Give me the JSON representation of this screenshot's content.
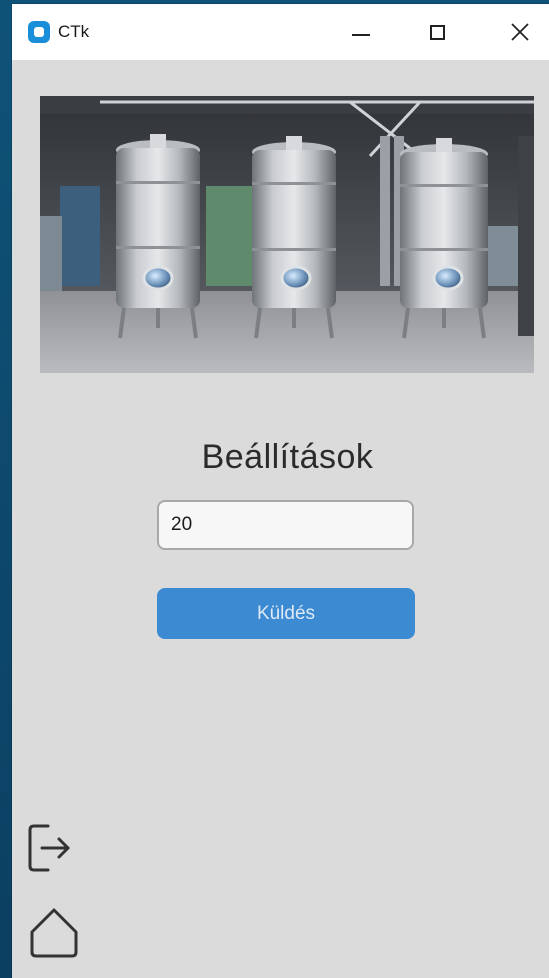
{
  "window": {
    "title": "CTk",
    "app_icon": "ctk-app-icon",
    "controls": [
      "minimize-icon",
      "maximize-icon",
      "close-icon"
    ]
  },
  "main": {
    "image": "stainless-steel-tanks-photo",
    "heading": "Beállítások",
    "input": {
      "value": "20"
    },
    "submit_label": "Küldés"
  },
  "sidebar": {
    "icons": [
      "logout-icon",
      "home-icon"
    ]
  },
  "colors": {
    "accent": "#3c8ad2",
    "background": "#dbdbdb",
    "titlebar": "#ffffff"
  }
}
